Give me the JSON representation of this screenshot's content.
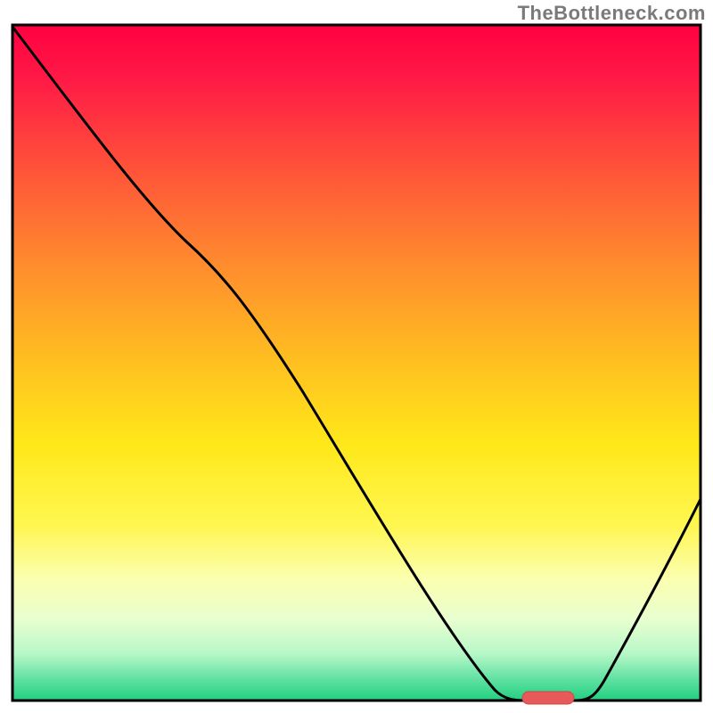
{
  "watermark": "TheBottleneck.com",
  "marker": {
    "color": "#e65a5a"
  },
  "chart_data": {
    "type": "line",
    "title": "",
    "xlabel": "",
    "ylabel": "",
    "xlim": [
      0,
      100
    ],
    "ylim": [
      0,
      100
    ],
    "grid": false,
    "legend": false,
    "annotations": [
      {
        "text": "TheBottleneck.com",
        "position": "top-right"
      }
    ],
    "series": [
      {
        "name": "bottleneck-curve",
        "x": [
          0,
          5,
          12,
          20,
          26,
          32,
          40,
          48,
          56,
          64,
          70,
          74,
          77,
          80,
          82,
          86,
          92,
          100
        ],
        "values": [
          100,
          92,
          82,
          72,
          68,
          60,
          48,
          34,
          20,
          8,
          2,
          0,
          0,
          0,
          2,
          10,
          22,
          30
        ]
      }
    ],
    "marker": {
      "x_range": [
        74,
        82
      ],
      "y": 0,
      "color": "#e65a5a",
      "shape": "rounded-rect"
    },
    "background_gradient": {
      "direction": "vertical",
      "stops": [
        {
          "pos": 0.0,
          "color": "#ff0040"
        },
        {
          "pos": 0.2,
          "color": "#ff4d3a"
        },
        {
          "pos": 0.5,
          "color": "#ffc020"
        },
        {
          "pos": 0.74,
          "color": "#fff650"
        },
        {
          "pos": 0.88,
          "color": "#e8ffd0"
        },
        {
          "pos": 1.0,
          "color": "#20d080"
        }
      ]
    }
  }
}
